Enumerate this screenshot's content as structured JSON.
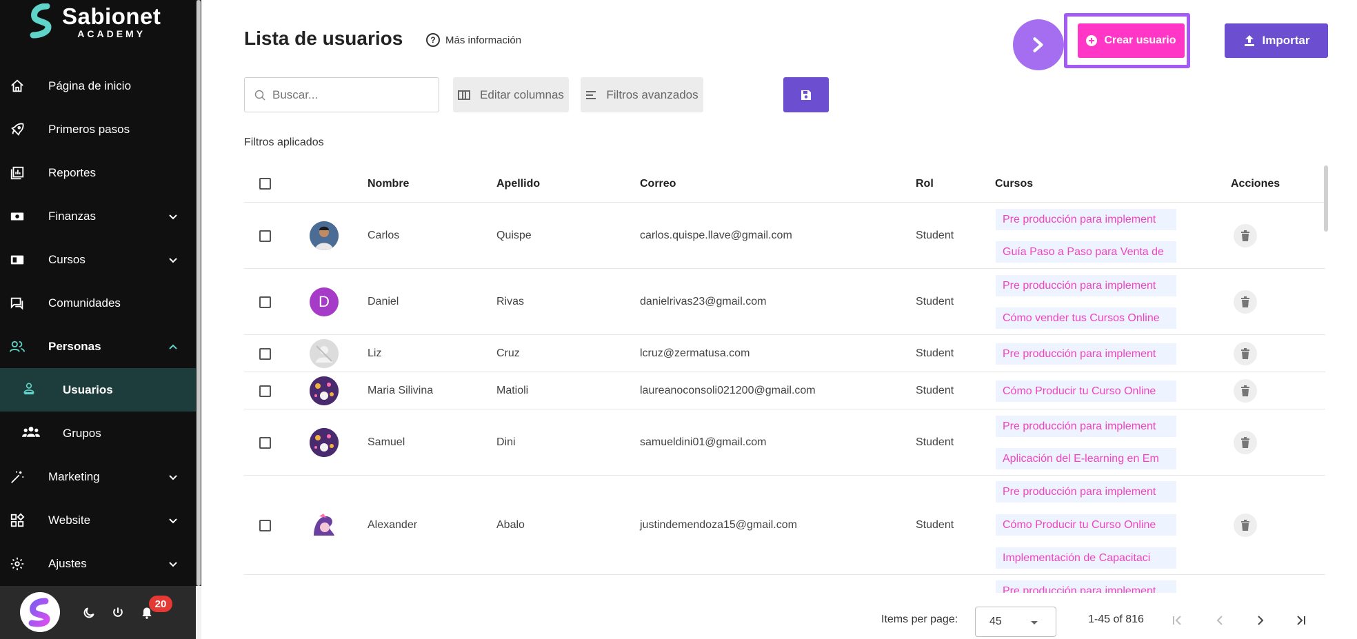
{
  "brand": {
    "title": "Sabionet",
    "subtitle": "ACADEMY"
  },
  "sidebar": {
    "items": [
      {
        "label": "Página de inicio",
        "icon": "home-icon"
      },
      {
        "label": "Primeros pasos",
        "icon": "rocket-icon"
      },
      {
        "label": "Reportes",
        "icon": "chart-icon"
      },
      {
        "label": "Finanzas",
        "icon": "money-icon"
      },
      {
        "label": "Cursos",
        "icon": "book-icon"
      },
      {
        "label": "Comunidades",
        "icon": "chat-icon"
      },
      {
        "label": "Personas",
        "icon": "people-icon"
      },
      {
        "label": "Marketing",
        "icon": "magic-wand-icon"
      },
      {
        "label": "Website",
        "icon": "widgets-icon"
      },
      {
        "label": "Ajustes",
        "icon": "gear-icon"
      }
    ],
    "sub_items": [
      {
        "label": "Usuarios",
        "icon": "user-badge-icon"
      },
      {
        "label": "Grupos",
        "icon": "group-icon"
      }
    ],
    "notifications_count": "20"
  },
  "header": {
    "title": "Lista de usuarios",
    "more_info": "Más información",
    "create_label": "Crear usuario",
    "import_label": "Importar"
  },
  "toolbar": {
    "search_placeholder": "Buscar...",
    "edit_columns": "Editar columnas",
    "advanced_filters": "Filtros avanzados",
    "filters_applied": "Filtros aplicados"
  },
  "table": {
    "columns": [
      "Nombre",
      "Apellido",
      "Correo",
      "Rol",
      "Cursos",
      "Acciones"
    ],
    "rows": [
      {
        "nombre": "Carlos",
        "apellido": "Quispe",
        "correo": "carlos.quispe.llave@gmail.com",
        "rol": "Student",
        "cursos": [
          "Pre producción para implement",
          "Guía Paso a Paso para Venta de"
        ]
      },
      {
        "nombre": "Daniel",
        "apellido": "Rivas",
        "correo": "danielrivas23@gmail.com",
        "rol": "Student",
        "cursos": [
          "Pre producción para implement",
          "Cómo vender tus Cursos Online"
        ]
      },
      {
        "nombre": "Liz",
        "apellido": "Cruz",
        "correo": "lcruz@zermatusa.com",
        "rol": "Student",
        "cursos": [
          "Pre producción para implement"
        ]
      },
      {
        "nombre": "Maria Silivina",
        "apellido": "Matioli",
        "correo": "laureanoconsoli021200@gmail.com",
        "rol": "Student",
        "cursos": [
          "Cómo Producir tu Curso Online"
        ]
      },
      {
        "nombre": "Samuel",
        "apellido": "Dini",
        "correo": "samueldini01@gmail.com",
        "rol": "Student",
        "cursos": [
          "Pre producción para implement",
          "Aplicación del E-learning en Em"
        ]
      },
      {
        "nombre": "Alexander",
        "apellido": "Abalo",
        "correo": "justindemendoza15@gmail.com",
        "rol": "Student",
        "cursos": [
          "Pre producción para implement",
          "Cómo Producir tu Curso Online",
          "Implementación de Capacitaci"
        ]
      },
      {
        "nombre": "",
        "apellido": "",
        "correo": "",
        "rol": "",
        "cursos": [
          "Pre producción para implement"
        ]
      }
    ],
    "avatar_letter_daniel": "D"
  },
  "pagination": {
    "items_per_page_label": "Items per page:",
    "items_per_page": "45",
    "range": "1-45 of 816"
  },
  "colors": {
    "sidebar_bg": "#101010",
    "accent_pink": "#ff36c6",
    "accent_purple": "#6c4fd0",
    "highlight": "#a45bf5",
    "active_teal": "#5fd4c8"
  }
}
